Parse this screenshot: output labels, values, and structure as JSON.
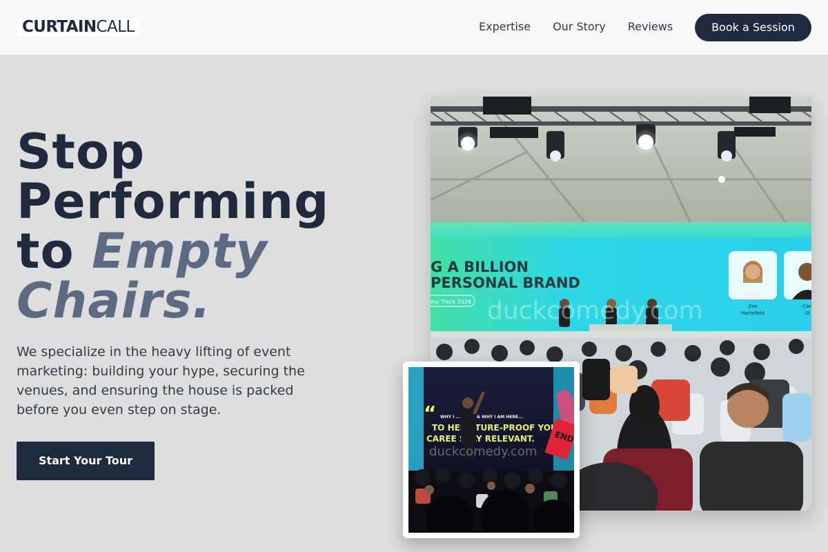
{
  "brand": {
    "logo_strong": "CURTAIN",
    "logo_light": "CALL"
  },
  "nav": {
    "links": [
      "Expertise",
      "Our Story",
      "Reviews"
    ],
    "cta": "Book a Session"
  },
  "hero": {
    "title_line1": "Stop",
    "title_line2": "Performing",
    "title_line3_plain": "to ",
    "title_line3_accent": "Empty",
    "title_line4_accent": "Chairs.",
    "subtitle": "We specialize in the heavy lifting of event marketing: building your hype, securing the venues, and ensuring the house is packed before you even step on stage.",
    "cta": "Start Your Tour"
  },
  "main_photo": {
    "screen_headline_1": "G A BILLION",
    "screen_headline_2": "PERSONAL BRAND",
    "screen_tag": "my Track 2026",
    "speaker_1": "Zoe",
    "speaker_1_last": "Hartsfield",
    "speaker_2": "Carl",
    "speaker_2_last": "Gl",
    "watermark": "duckcomedy.com"
  },
  "inset_photo": {
    "screen_line_1": "WHY I ... BOOK & WHY I AM HERE...",
    "screen_line_2": "TO HEL   UTURE-PROOF YOUR",
    "screen_line_3": "CAREE   STAY RELEVANT.",
    "sign_text": "END",
    "watermark": "duckcomedy.com"
  },
  "colors": {
    "navy": "#1f2a3d",
    "accent_slate": "#5c6a84",
    "background": "#dedede",
    "header_bg": "#f8f8f8",
    "screen_cyan": "#2cd9e6",
    "screen_green": "#5ee08a"
  }
}
